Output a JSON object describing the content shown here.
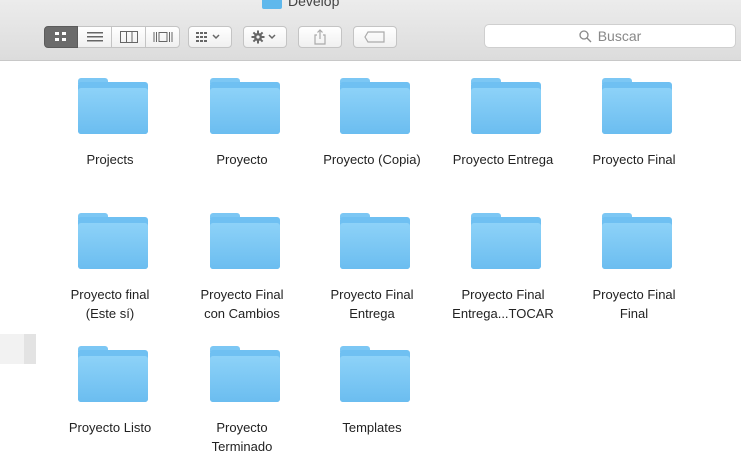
{
  "window": {
    "title": "Develop"
  },
  "toolbar": {
    "view_modes": [
      {
        "name": "icon-view",
        "active": true
      },
      {
        "name": "list-view",
        "active": false
      },
      {
        "name": "column-view",
        "active": false
      },
      {
        "name": "gallery-view",
        "active": false
      }
    ],
    "search_placeholder": "Buscar"
  },
  "colors": {
    "folder": "#6fc0f2",
    "folder_light": "#8dd2f8",
    "toolbar": "#e4e4e4",
    "active_view": "#6b6b6b"
  },
  "folders": [
    {
      "label": "Projects"
    },
    {
      "label": "Proyecto"
    },
    {
      "label": "Proyecto (Copia)"
    },
    {
      "label": "Proyecto Entrega"
    },
    {
      "label": "Proyecto Final"
    },
    {
      "label": "Proyecto final\n(Este sí)"
    },
    {
      "label": "Proyecto Final\ncon Cambios"
    },
    {
      "label": "Proyecto Final\nEntrega"
    },
    {
      "label": "Proyecto Final\nEntrega...TOCAR"
    },
    {
      "label": "Proyecto Final\nFinal"
    },
    {
      "label": "Proyecto Listo"
    },
    {
      "label": "Proyecto\nTerminado"
    },
    {
      "label": "Templates"
    }
  ]
}
